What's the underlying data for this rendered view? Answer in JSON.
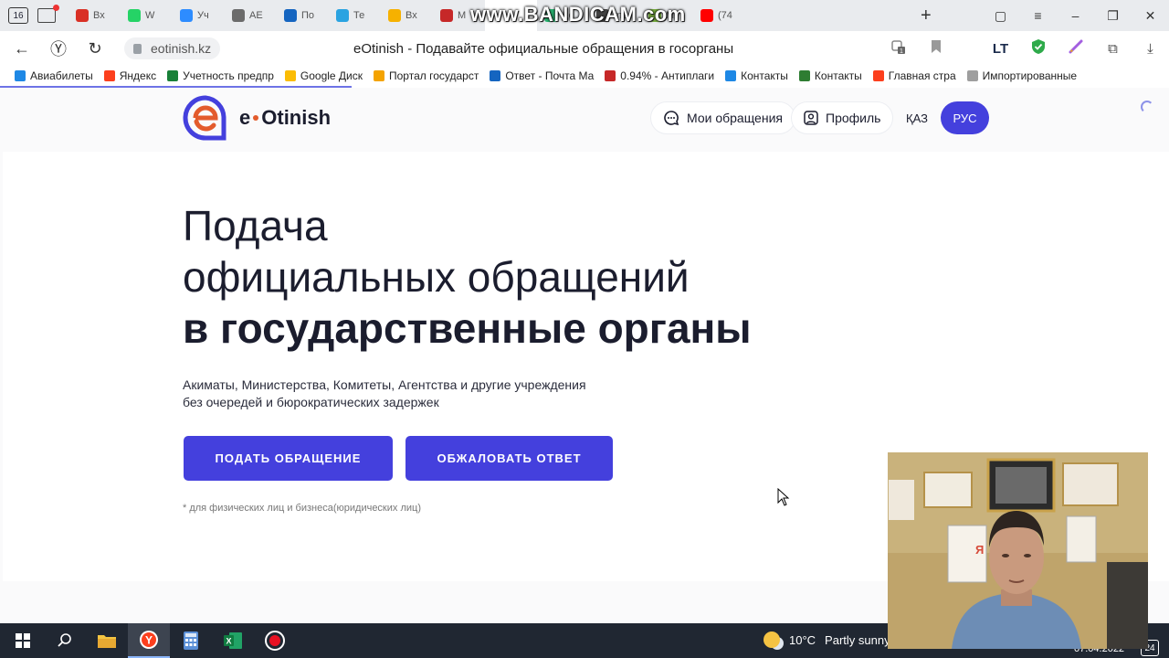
{
  "browser": {
    "tab_count": "16",
    "tabs": [
      {
        "label": "Вх",
        "color": "#d93025"
      },
      {
        "label": "W",
        "color": "#25d366"
      },
      {
        "label": "Уч",
        "color": "#2d8cff"
      },
      {
        "label": "АЕ",
        "color": "#6b6b6b"
      },
      {
        "label": "По",
        "color": "#1565c0"
      },
      {
        "label": "Те",
        "color": "#2aa3e1"
      },
      {
        "label": "Вх",
        "color": "#f6b100"
      },
      {
        "label": "М",
        "color": "#c62828"
      },
      {
        "label": "",
        "color": "#ffffff",
        "active": true
      },
      {
        "label": "Де",
        "color": "#2bb673"
      },
      {
        "label": "mo",
        "color": "#444444"
      },
      {
        "label": "М",
        "color": "#7cb342"
      },
      {
        "label": "(74",
        "color": "#ff0000"
      }
    ],
    "watermark": "www.BANDICAM.com",
    "url": "eotinish.kz",
    "page_title": "eOtinish - Подавайте официальные обращения в госорганы",
    "extension_badge": "1",
    "bookmarks": [
      {
        "label": "Авиабилеты",
        "color": "#1e88e5"
      },
      {
        "label": "Яндекс",
        "color": "#fc3f1d"
      },
      {
        "label": "Учетность предпр",
        "color": "#188038"
      },
      {
        "label": "Google Диск",
        "color": "#fbbc04"
      },
      {
        "label": "Портал государст",
        "color": "#f4a300"
      },
      {
        "label": "Ответ - Почта Ма",
        "color": "#1565c0"
      },
      {
        "label": "0.94% - Антиплаги",
        "color": "#c62828"
      },
      {
        "label": "Контакты",
        "color": "#1e88e5"
      },
      {
        "label": "Контакты",
        "color": "#2e7d32"
      },
      {
        "label": "Главная стра",
        "color": "#fc3f1d"
      },
      {
        "label": "Импортированные",
        "color": "#9e9e9e"
      }
    ]
  },
  "site": {
    "logo_text_e": "e",
    "logo_text_rest": "Otinish",
    "nav": {
      "my_requests": "Мои обращения",
      "profile": "Профиль",
      "lang_kaz": "ҚАЗ",
      "lang_rus": "РУС"
    },
    "hero": {
      "line1": "Подача",
      "line2": "официальных обращений",
      "line3": "в государственные органы",
      "sub1": "Акиматы, Министерства, Комитеты, Агентства и другие учреждения",
      "sub2": "без очередей и бюрократических задержек",
      "cta_submit": "ПОДАТЬ ОБРАЩЕНИЕ",
      "cta_appeal": "ОБЖАЛОВАТЬ ОТВЕТ",
      "note": "* для физических лиц и бизнеса(юридических лиц)"
    },
    "colors": {
      "accent": "#4440dd",
      "logo_orange": "#e35b2c",
      "text": "#1b1d2e"
    }
  },
  "taskbar": {
    "temperature": "10°C",
    "weather": "Partly sunny",
    "date": "07.04.2022",
    "notifications": "24"
  }
}
